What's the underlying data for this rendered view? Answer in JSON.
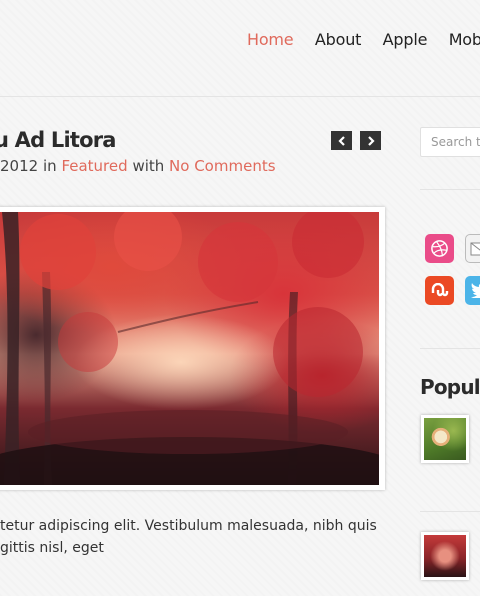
{
  "nav": {
    "items": [
      {
        "label": "Home",
        "active": true
      },
      {
        "label": "About",
        "active": false
      },
      {
        "label": "Apple",
        "active": false
      },
      {
        "label": "Mobile",
        "active": false
      }
    ]
  },
  "post": {
    "title": "u Ad Litora",
    "meta": {
      "date": "2012",
      "in_word": "in",
      "category": "Featured",
      "with_word": "with",
      "comments": "No Comments"
    },
    "excerpt_lines": [
      "tetur adipiscing elit. Vestibulum malesuada, nibh quis",
      "gittis nisl, eget"
    ]
  },
  "post_nav": {
    "prev_icon": "arrow-left-icon",
    "next_icon": "arrow-right-icon"
  },
  "sidebar": {
    "search_placeholder": "Search th",
    "social_icons": [
      "dribbble-icon",
      "email-icon",
      "stumbleupon-icon",
      "twitter-icon"
    ],
    "popular_title": "Popula"
  },
  "colors": {
    "accent": "#e06a5c",
    "dribbble": "#ea4c89",
    "stumbleupon": "#eb4924",
    "twitter": "#4cb4e8",
    "dark": "#333333"
  }
}
